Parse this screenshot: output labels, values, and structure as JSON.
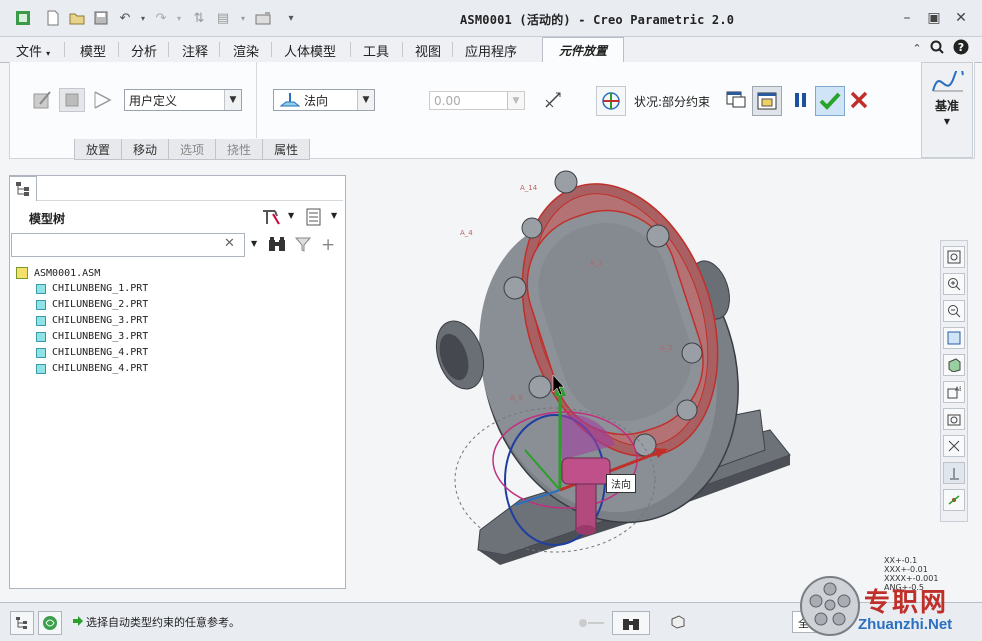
{
  "window": {
    "title": "ASM0001 (活动的) - Creo Parametric 2.0"
  },
  "menu": {
    "items": [
      "文件",
      "模型",
      "分析",
      "注释",
      "渲染",
      "人体模型",
      "工具",
      "视图",
      "应用程序"
    ],
    "active_tab": "元件放置"
  },
  "ribbon": {
    "constraint_set": "用户定义",
    "constraint_type": "法向",
    "offset_value": "0.00",
    "status": "状况:部分约束",
    "datum_label": "基准",
    "subtabs": [
      "放置",
      "移动",
      "选项",
      "挠性",
      "属性"
    ]
  },
  "model_tree": {
    "title": "模型树",
    "search_placeholder": "",
    "root": "ASM0001.ASM",
    "parts": [
      "CHILUNBENG_1.PRT",
      "CHILUNBENG_2.PRT",
      "CHILUNBENG_3.PRT",
      "CHILUNBENG_3.PRT",
      "CHILUNBENG_4.PRT",
      "CHILUNBENG_4.PRT"
    ]
  },
  "viewport": {
    "tooltip": "法向",
    "tolerance_lines": [
      "XX+-0.1",
      "XXX+-0.01",
      "XXXX+-0.001",
      "ANG+-0.5"
    ]
  },
  "status": {
    "message": "选择自动类型约束的任意参考。",
    "filter": "全部"
  },
  "watermark": {
    "cn": "专职网",
    "url": "Zhuanzhi.Net"
  },
  "colors": {
    "accent_red": "#c0302a",
    "confirm_green": "#29a329",
    "pause_blue": "#1f4fa0"
  }
}
